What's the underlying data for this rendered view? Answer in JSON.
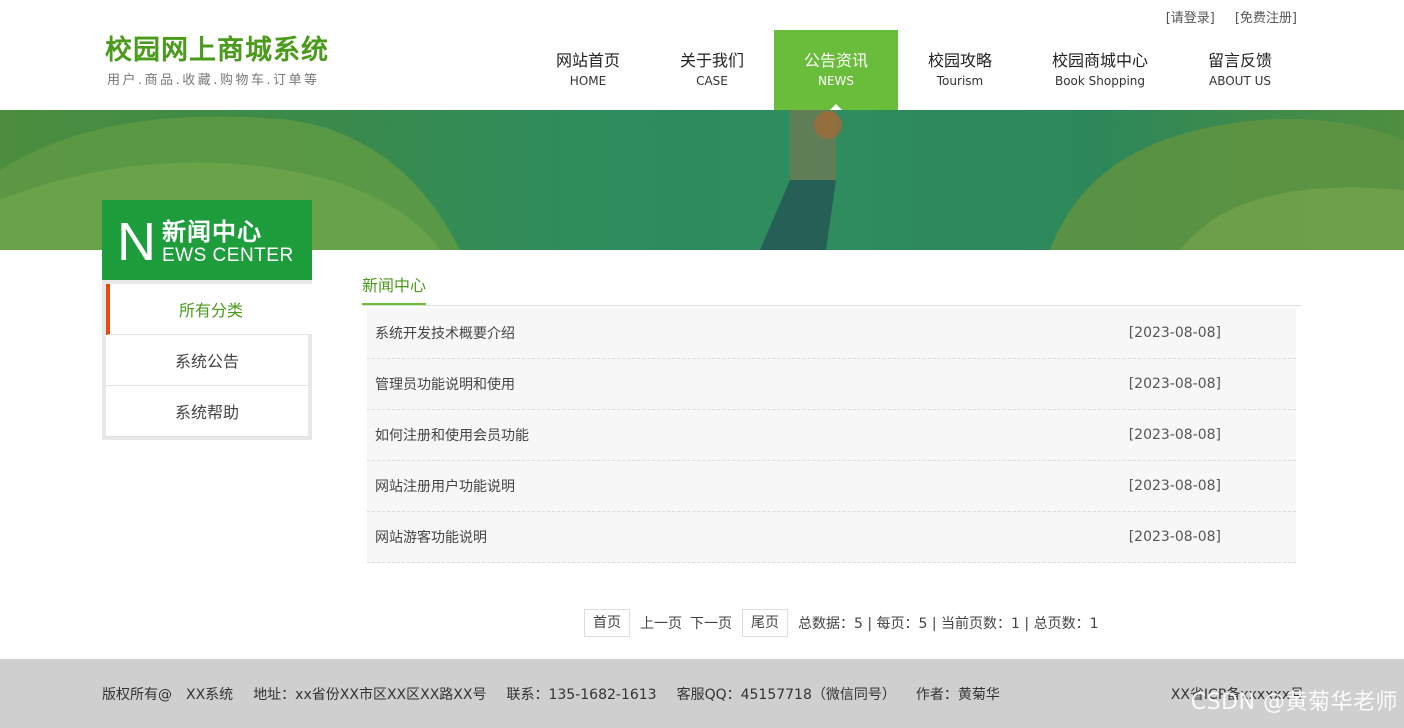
{
  "top_links": {
    "login": "[请登录]",
    "register": "[免费注册]"
  },
  "logo": {
    "title": "校园网上商城系统",
    "subtitle": "用户.商品.收藏.购物车.订单等"
  },
  "nav": [
    {
      "cn": "网站首页",
      "en": "HOME"
    },
    {
      "cn": "关于我们",
      "en": "CASE"
    },
    {
      "cn": "公告资讯",
      "en": "NEWS"
    },
    {
      "cn": "校园攻略",
      "en": "Tourism"
    },
    {
      "cn": "校园商城中心",
      "en": "Book Shopping"
    },
    {
      "cn": "留言反馈",
      "en": "ABOUT US"
    }
  ],
  "side": {
    "head_letter": "N",
    "head_cn": "新闻中心",
    "head_en": "EWS CENTER",
    "items": [
      "所有分类",
      "系统公告",
      "系统帮助"
    ]
  },
  "main": {
    "title": "新闻中心",
    "news": [
      {
        "title": "系统开发技术概要介绍",
        "date": "[2023-08-08]"
      },
      {
        "title": "管理员功能说明和使用",
        "date": "[2023-08-08]"
      },
      {
        "title": "如何注册和使用会员功能",
        "date": "[2023-08-08]"
      },
      {
        "title": "网站注册用户功能说明",
        "date": "[2023-08-08]"
      },
      {
        "title": "网站游客功能说明",
        "date": "[2023-08-08]"
      }
    ]
  },
  "pager": {
    "first": "首页",
    "prev": "上一页",
    "next": "下一页",
    "last": "尾页",
    "summary": "总数据：5 | 每页：5 | 当前页数：1 | 总页数：1"
  },
  "footer": {
    "copyright": "版权所有@　XX系统",
    "address": "地址：xx省份XX市区XX区XX路XX号",
    "phone": "联系：135-1682-1613",
    "qq": "客服QQ：45157718（微信同号）",
    "author": "作者：黄菊华",
    "icp": "XX省ICP备xxxxxx号",
    "watermark": "CSDN @黄菊华老师"
  },
  "colors": {
    "brand_green": "#6abd3b",
    "logo_green": "#4a9a1c",
    "side_head": "#1e9d3d",
    "active_marker": "#e8490f",
    "footer_bg": "#cfcfcf"
  }
}
